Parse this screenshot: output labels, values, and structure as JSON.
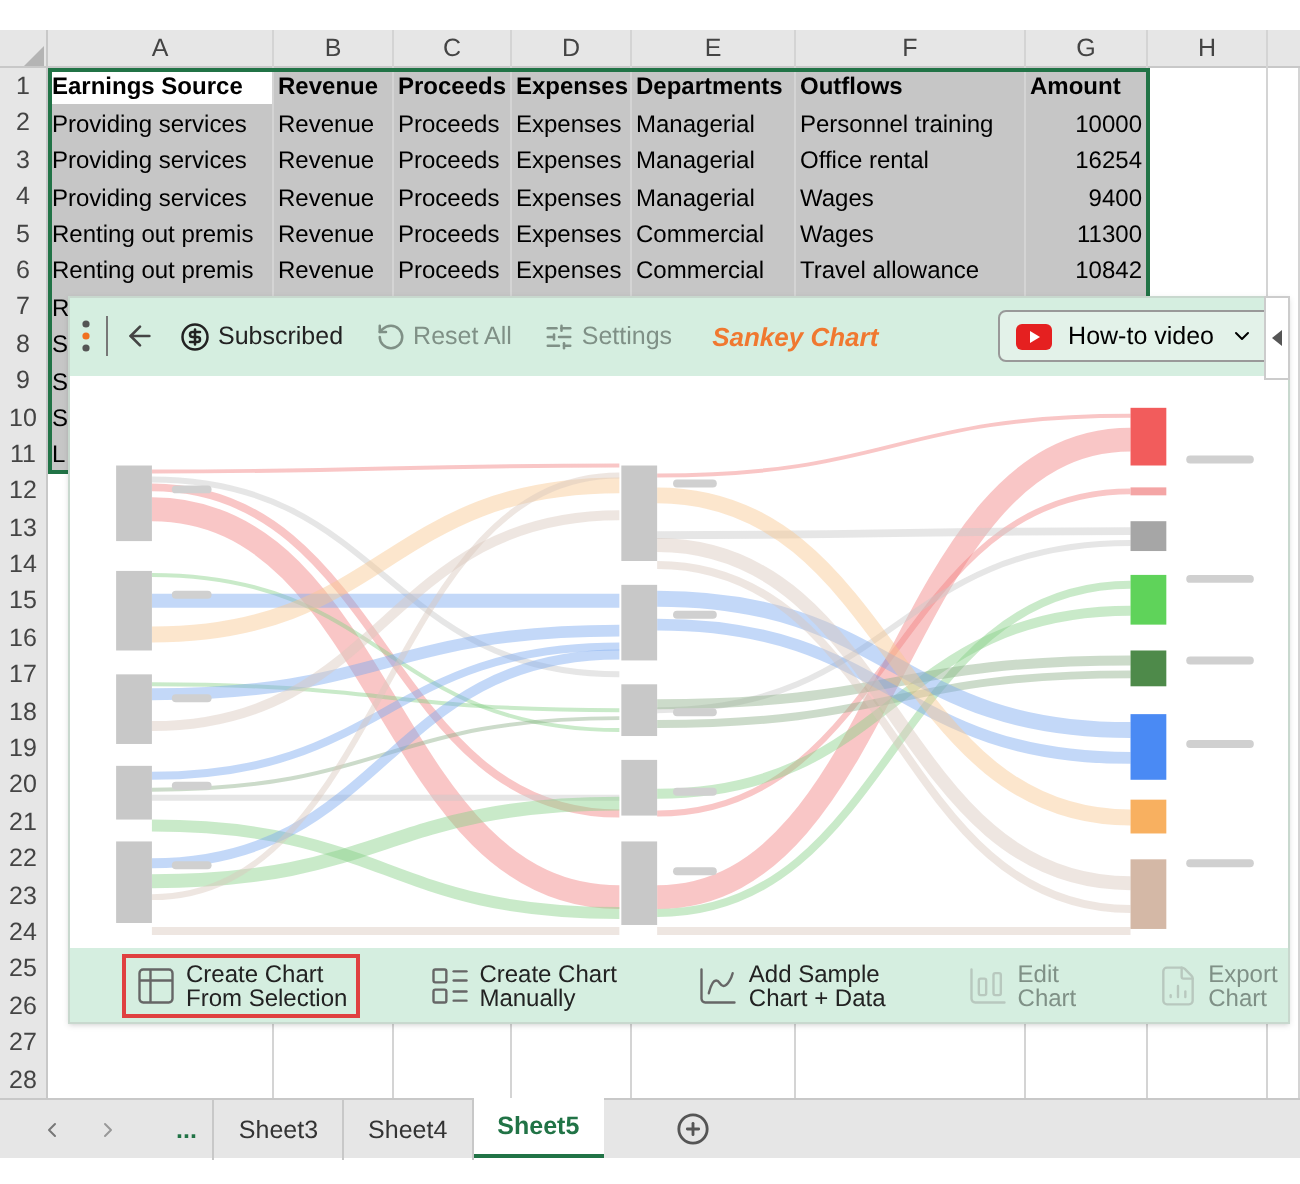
{
  "columns": [
    "A",
    "B",
    "C",
    "D",
    "E",
    "F",
    "G",
    "H"
  ],
  "rows": [
    {
      "number": "1",
      "header": true,
      "cells": [
        "Earnings Source",
        "Revenue",
        "Proceeds",
        "Expenses",
        "Departments",
        "Outflows",
        "Amount"
      ]
    },
    {
      "number": "2",
      "cells": [
        "Providing services",
        "Revenue",
        "Proceeds",
        "Expenses",
        "Managerial",
        "Personnel training",
        "10000"
      ]
    },
    {
      "number": "3",
      "cells": [
        "Providing services",
        "Revenue",
        "Proceeds",
        "Expenses",
        "Managerial",
        "Office rental",
        "16254"
      ]
    },
    {
      "number": "4",
      "cells": [
        "Providing services",
        "Revenue",
        "Proceeds",
        "Expenses",
        "Managerial",
        "Wages",
        "9400"
      ]
    },
    {
      "number": "5",
      "cells": [
        "Renting out premis",
        "Revenue",
        "Proceeds",
        "Expenses",
        "Commercial",
        "Wages",
        "11300"
      ]
    },
    {
      "number": "6",
      "cells": [
        "Renting out premis",
        "Revenue",
        "Proceeds",
        "Expenses",
        "Commercial",
        "Travel allowance",
        "10842"
      ]
    },
    {
      "number": "7",
      "cells": [
        "R"
      ]
    },
    {
      "number": "8",
      "cells": [
        "S"
      ]
    },
    {
      "number": "9",
      "cells": [
        "S"
      ]
    },
    {
      "number": "10",
      "cells": [
        "S"
      ]
    },
    {
      "number": "11",
      "cells": [
        "L"
      ]
    },
    {
      "number": "12",
      "cells": []
    },
    {
      "number": "13",
      "cells": []
    },
    {
      "number": "14",
      "cells": []
    },
    {
      "number": "15",
      "cells": []
    },
    {
      "number": "16",
      "cells": []
    },
    {
      "number": "17",
      "cells": []
    },
    {
      "number": "18",
      "cells": []
    },
    {
      "number": "19",
      "cells": []
    },
    {
      "number": "20",
      "cells": []
    },
    {
      "number": "21",
      "cells": []
    },
    {
      "number": "22",
      "cells": []
    },
    {
      "number": "23",
      "cells": []
    },
    {
      "number": "24",
      "cells": []
    },
    {
      "number": "25",
      "cells": []
    },
    {
      "number": "26",
      "cells": []
    },
    {
      "number": "27",
      "cells": []
    },
    {
      "number": "28",
      "cells": []
    }
  ],
  "pane": {
    "toolbar": [
      {
        "label": "Subscribed",
        "disabled": false
      },
      {
        "label": "Reset All",
        "disabled": true
      },
      {
        "label": "Settings",
        "disabled": true
      }
    ],
    "title": "Sankey Chart",
    "video_button": "How-to video",
    "actions": [
      {
        "label": "Create Chart\nFrom Selection",
        "selected": true,
        "disabled": false
      },
      {
        "label": "Create Chart\nManually",
        "selected": false,
        "disabled": false
      },
      {
        "label": "Add Sample\nChart + Data",
        "selected": false,
        "disabled": false
      },
      {
        "label": "Edit\nChart",
        "selected": false,
        "disabled": true
      },
      {
        "label": "Export\nChart",
        "selected": false,
        "disabled": true
      }
    ]
  },
  "sheet_tabs": {
    "more": "...",
    "tabs": [
      {
        "label": "Sheet3",
        "selected": false
      },
      {
        "label": "Sheet4",
        "selected": false
      },
      {
        "label": "Sheet5",
        "selected": true
      }
    ]
  }
}
